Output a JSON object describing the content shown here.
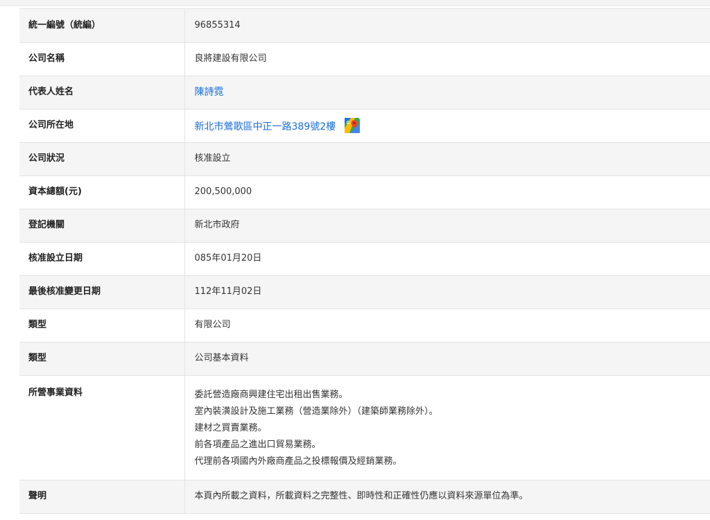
{
  "rows": {
    "uid": {
      "label": "統一編號（統編）",
      "value": "96855314"
    },
    "name": {
      "label": "公司名稱",
      "value": "良將建設有限公司"
    },
    "rep": {
      "label": "代表人姓名",
      "value": "陳詩霓"
    },
    "address": {
      "label": "公司所在地",
      "value": "新北市鶯歌區中正一路389號2樓"
    },
    "status": {
      "label": "公司狀況",
      "value": "核准設立"
    },
    "capital": {
      "label": "資本總額(元)",
      "value": "200,500,000"
    },
    "registrar": {
      "label": "登記機關",
      "value": "新北市政府"
    },
    "approved": {
      "label": "核准設立日期",
      "value": "085年01月20日"
    },
    "changed": {
      "label": "最後核准變更日期",
      "value": "112年11月02日"
    },
    "type1": {
      "label": "類型",
      "value": "有限公司"
    },
    "type2": {
      "label": "類型",
      "value": "公司基本資料"
    },
    "business": {
      "label": "所營事業資料",
      "items": [
        "委託營造廠商興建住宅出租出售業務。",
        "室內裝潢設計及施工業務（營造業除外）（建築師業務除外）。",
        "建材之買賣業務。",
        "前各項產品之進出口貿易業務。",
        "代理前各項國內外廠商產品之投標報價及經銷業務。"
      ]
    },
    "statement": {
      "label": "聲明",
      "value": "本頁內所載之資料，所載資料之完整性、即時性和正確性仍應以資料來源單位為準。"
    }
  },
  "icons": {
    "map": "google-maps-icon"
  },
  "colors": {
    "link": "#1a6ed8",
    "row_shade": "#f5f5f5",
    "border": "#e3e3e3"
  }
}
